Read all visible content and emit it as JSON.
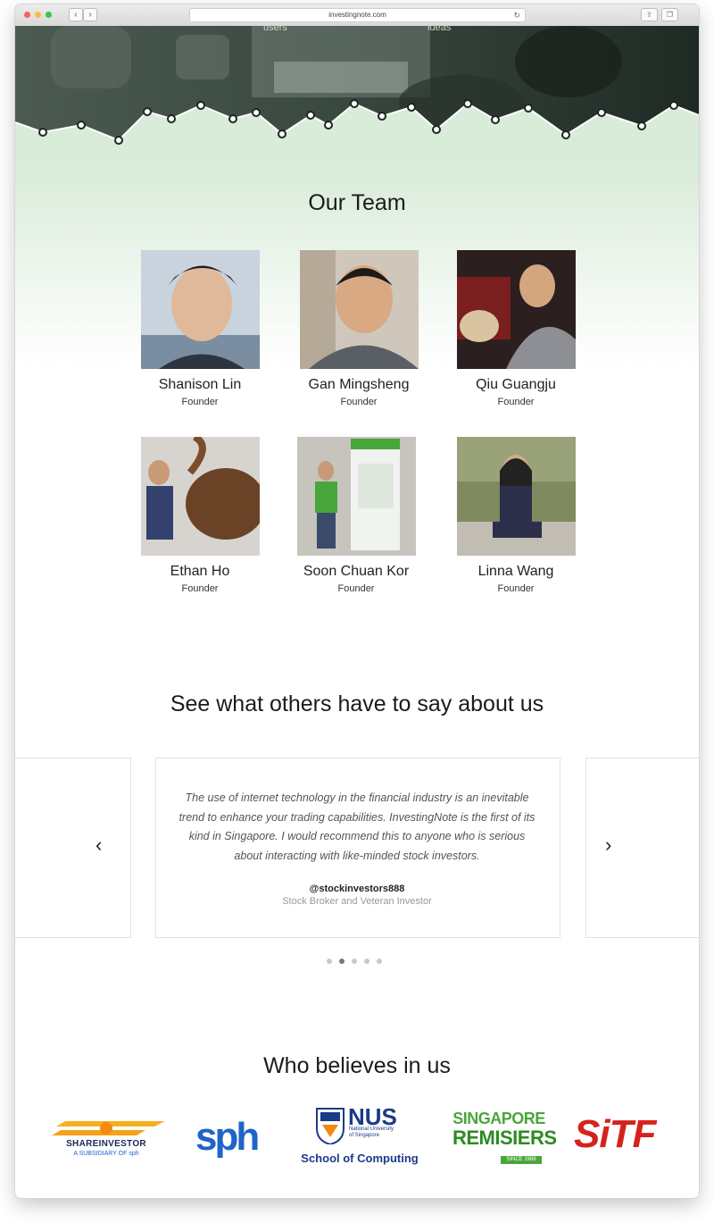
{
  "browser": {
    "url": "investingnote.com"
  },
  "hero": {
    "partial_label_left": "users",
    "partial_label_right": "ideas"
  },
  "team": {
    "title": "Our Team",
    "members": [
      {
        "name": "Shanison Lin",
        "role": "Founder"
      },
      {
        "name": "Gan Mingsheng",
        "role": "Founder"
      },
      {
        "name": "Qiu Guangju",
        "role": "Founder"
      },
      {
        "name": "Ethan Ho",
        "role": "Founder"
      },
      {
        "name": "Soon Chuan Kor",
        "role": "Founder"
      },
      {
        "name": "Linna Wang",
        "role": "Founder"
      }
    ]
  },
  "testimonials": {
    "title": "See what others have to say about us",
    "quote": "The use of internet technology in the financial industry is an inevitable trend to enhance your trading capabilities. InvestingNote is the first of its kind in Singapore. I would recommend this to anyone who is serious about interacting with like-minded stock investors.",
    "handle": "@stockinvestors888",
    "author_role": "Stock Broker and Veteran Investor",
    "dot_count": 5,
    "active_dot": 2
  },
  "believers": {
    "title": "Who believes in us",
    "logos": {
      "shareinvestor": {
        "name": "SHAREINVESTOR",
        "sub": "A SUBSIDIARY OF sph"
      },
      "sph": {
        "name": "sph"
      },
      "nus": {
        "name": "NUS",
        "sub1": "National University",
        "sub2": "of Singapore",
        "school": "School of Computing"
      },
      "remisiers": {
        "line1": "SINGAPORE",
        "line2": "REMISIERS",
        "line3": "SINCE 1986"
      },
      "sitf": {
        "name": "SiTF"
      }
    }
  },
  "colors": {
    "hero_dark": "#2f3a33",
    "hero_green_fade": "#d9ebd9",
    "accent_green": "#4aa63a",
    "sph_blue": "#1f64c8",
    "sitf_red": "#d6221d"
  }
}
